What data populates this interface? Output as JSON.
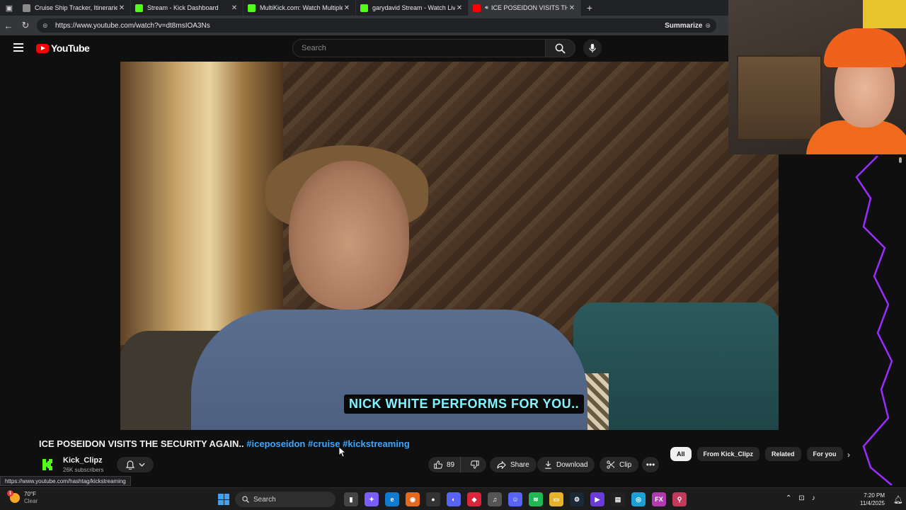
{
  "browser": {
    "tabs": [
      {
        "title": "Cruise Ship Tracker, Itineraries, Sc",
        "favicon_color": "#8a8a8a",
        "active": false
      },
      {
        "title": "Stream - Kick Dashboard",
        "favicon_color": "#53fc18",
        "active": false
      },
      {
        "title": "MultiKick.com: Watch Multiple St",
        "favicon_color": "#53fc18",
        "active": false
      },
      {
        "title": "garydavid Stream - Watch Live on",
        "favicon_color": "#53fc18",
        "active": false
      },
      {
        "title": "ICE POSEIDON VISITS THE SE",
        "favicon_color": "#ff0000",
        "active": true
      }
    ],
    "url": "https://www.youtube.com/watch?v=dt8msIOA3Ns",
    "summarize_label": "Summarize"
  },
  "youtube": {
    "logo_text": "YouTube",
    "search_placeholder": "Search"
  },
  "video": {
    "caption": "NICK WHITE PERFORMS FOR YOU..",
    "title_main": "ICE POSEIDON VISITS THE SECURITY AGAIN..",
    "hashtags": [
      "#iceposeidon",
      "#cruise",
      "#kickstreaming"
    ]
  },
  "channel": {
    "name": "Kick_Clipz",
    "subscribers": "26K subscribers"
  },
  "actions": {
    "likes": "89",
    "share": "Share",
    "download": "Download",
    "clip": "Clip"
  },
  "chips": [
    {
      "label": "All",
      "active": true
    },
    {
      "label": "From Kick_Clipz",
      "active": false
    },
    {
      "label": "Related",
      "active": false
    },
    {
      "label": "For you",
      "active": false
    }
  ],
  "status_url": "https://www.youtube.com/hashtag/kickstreaming",
  "taskbar": {
    "weather_temp": "70°F",
    "weather_desc": "Clear",
    "weather_badge": "1",
    "search_label": "Search",
    "time": "7:20 PM",
    "date": "11/4/2025"
  },
  "colors": {
    "accent_link": "#3ea6ff",
    "brand_red": "#ff0000",
    "kick_green": "#53fc18",
    "caption_text": "#7ff5ff"
  }
}
